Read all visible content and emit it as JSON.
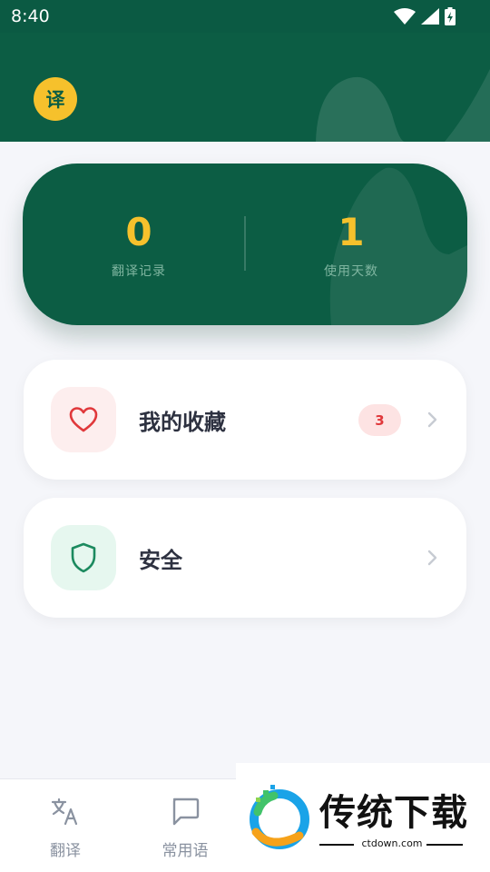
{
  "status_bar": {
    "time": "8:40"
  },
  "header": {
    "app_badge": "译"
  },
  "stats": [
    {
      "value": "0",
      "label": "翻译记录"
    },
    {
      "value": "1",
      "label": "使用天数"
    }
  ],
  "menu": {
    "favorites": {
      "label": "我的收藏",
      "count": "3",
      "icon": "heart-icon"
    },
    "security": {
      "label": "安全",
      "icon": "shield-icon"
    }
  },
  "bottom_nav": {
    "items": [
      {
        "label": "翻译",
        "icon": "translate-icon"
      },
      {
        "label": "常用语",
        "icon": "chat-bubble-icon"
      }
    ]
  },
  "watermark": {
    "text": "传统下载",
    "url": "ctdown.com"
  },
  "colors": {
    "primary": "#0c5d44",
    "accent": "#f6c12c",
    "favorite_red": "#e0383b",
    "security_green": "#1c8a5f"
  }
}
